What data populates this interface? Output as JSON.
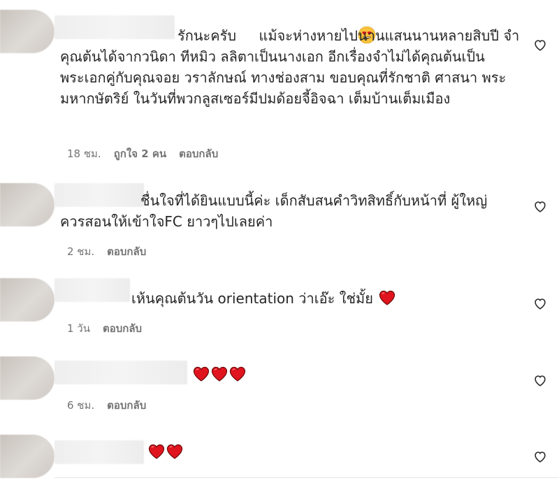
{
  "comments": [
    {
      "text": "รักนะครับ",
      "text_after_emoji": "แม้จะห่างหายไปนานแสนนานหลายสิบปี จำคุณต้นได้จากวนิดา ทีหมิว ลลิตาเป็นนางเอก อีกเรื่องจำไม่ได้คุณต้นเป็นพระเอกคู่กับคุณจอย วราลักษณ์ ทางช่องสาม ขอบคุณที่รักชาติ ศาสนา พระมหากษัตริย์ ในวันที่พวกลูสเซอร์มีปมด้อยจี้อิจฉา เต็มบ้านเต็มเมือง",
      "time": "18 ชม.",
      "likes": "ถูกใจ 2 คน",
      "reply": "ตอบกลับ"
    },
    {
      "text": "ชื่นใจที่ได้ยินแบบนี้ค่ะ เด็กสับสนคำวิทสิทธิ์กับหน้าที่ ผู้ใหญ่ควรสอนให้เข้าใจFC ยาวๆไปเลยค่า",
      "time": "2 ชม.",
      "reply": "ตอบกลับ"
    },
    {
      "text": "เห้นคุณต้นวัน orientation ว่าเอ๊ะ ใช่มั้ย",
      "time": "1 วัน",
      "reply": "ตอบกลับ"
    },
    {
      "text": "",
      "time": "6 ชม.",
      "reply": "ตอบกลับ"
    },
    {
      "text": ""
    }
  ],
  "icons": {
    "like": "heart-outline-icon",
    "emoji_heart": "red-heart-emoji",
    "emoji_face": "heart-eyes-emoji"
  },
  "colors": {
    "text": "#262626",
    "secondary": "#737373",
    "heart_red": "#e0141e"
  }
}
